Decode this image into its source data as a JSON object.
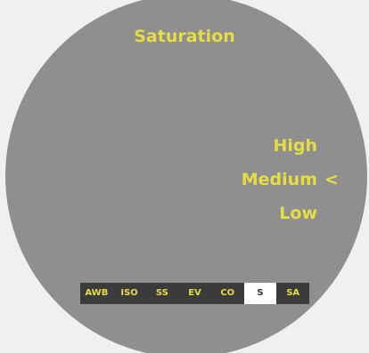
{
  "screen": {
    "title": "Saturation"
  },
  "options": [
    {
      "label": "High",
      "selected": false,
      "marker": ""
    },
    {
      "label": "Medium",
      "selected": true,
      "marker": "<"
    },
    {
      "label": "Low",
      "selected": false,
      "marker": ""
    }
  ],
  "tabs": [
    {
      "label": "AWB",
      "active": false
    },
    {
      "label": "ISO",
      "active": false
    },
    {
      "label": "SS",
      "active": false
    },
    {
      "label": "EV",
      "active": false
    },
    {
      "label": "CO",
      "active": false
    },
    {
      "label": "S",
      "active": true
    },
    {
      "label": "SA",
      "active": false
    }
  ],
  "colors": {
    "accent": "#e6dc43",
    "dial": "#8f8f8f",
    "tab_bar": "#3b3b3b",
    "tab_active_bg": "#ffffff"
  }
}
